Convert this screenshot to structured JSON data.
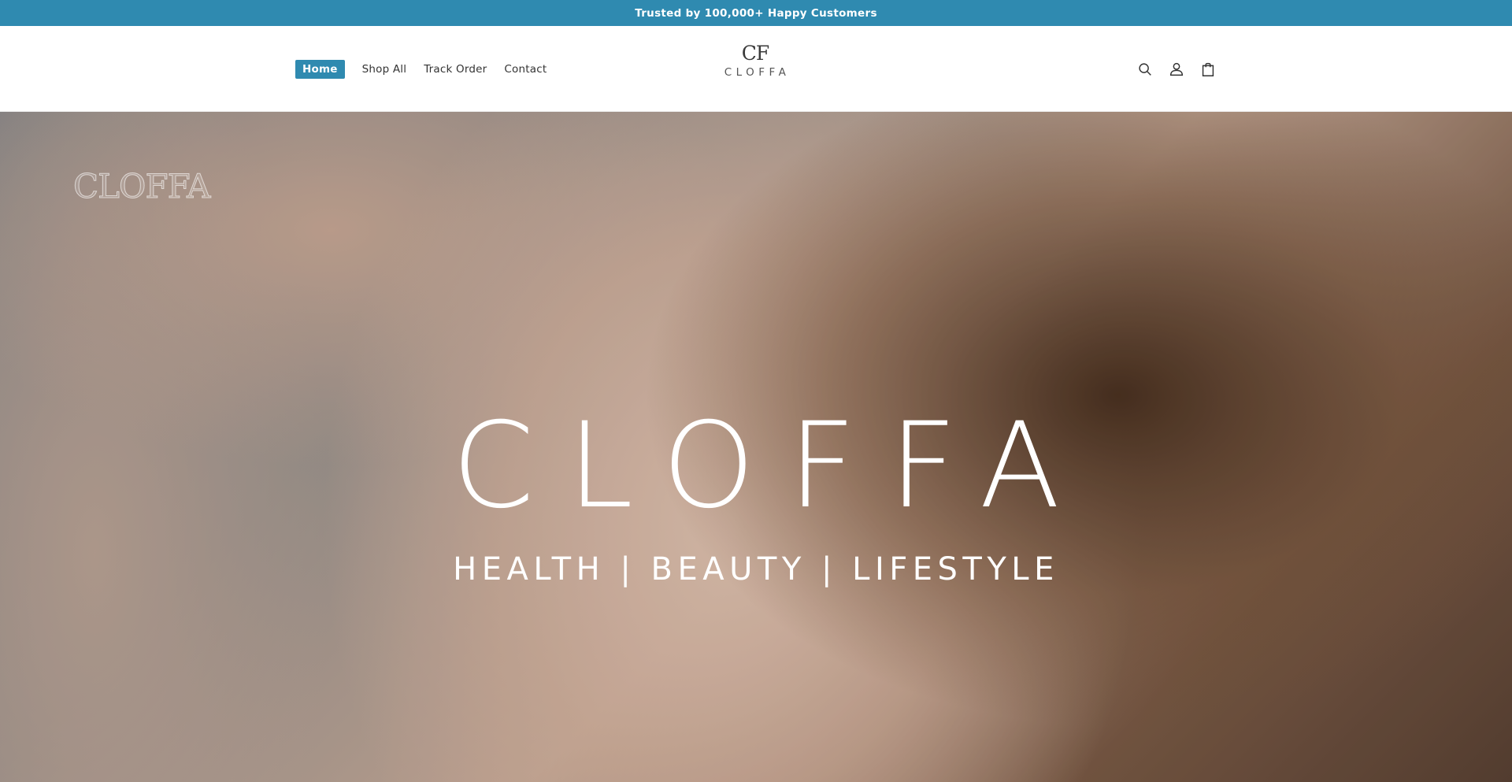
{
  "announcement": {
    "text": "Trusted by 100,000+ Happy Customers"
  },
  "header": {
    "nav": [
      {
        "label": "Home",
        "active": true
      },
      {
        "label": "Shop All",
        "active": false
      },
      {
        "label": "Track Order",
        "active": false
      },
      {
        "label": "Contact",
        "active": false
      }
    ],
    "logo": {
      "monogram": "CF",
      "name": "CLOFFA"
    },
    "icons": [
      "search-icon",
      "account-icon",
      "cart-icon"
    ]
  },
  "hero": {
    "watermark": "CLOFFA",
    "title": "CLOFFA",
    "tagline": "HEALTH | BEAUTY | LIFESTYLE"
  },
  "colors": {
    "accent": "#2f8ab0",
    "text": "#333333",
    "hero_text": "#ffffff"
  }
}
